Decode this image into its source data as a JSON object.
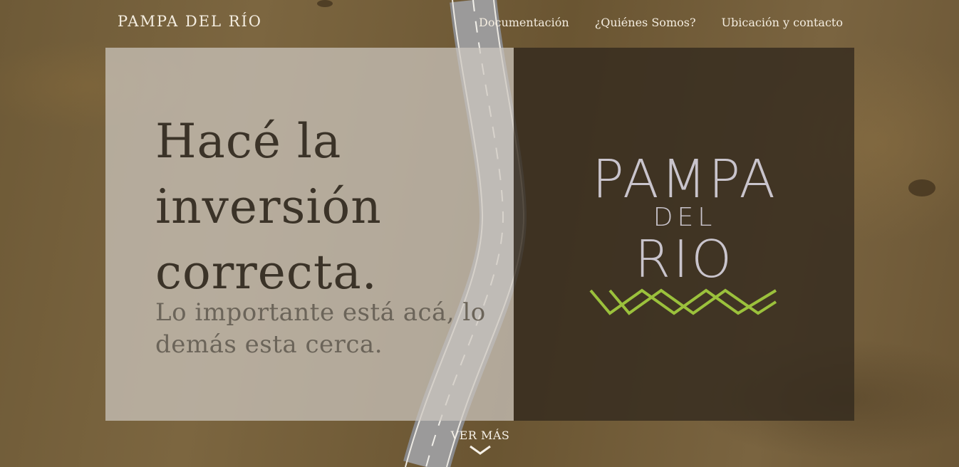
{
  "brand": "PAMPA DEL RÍO",
  "nav": {
    "items": [
      {
        "label": "Documentación"
      },
      {
        "label": "¿Quiénes Somos?"
      },
      {
        "label": "Ubicación y contacto"
      }
    ]
  },
  "hero": {
    "headline": "Hacé la inversión correcta.",
    "subline": "Lo importante está acá, lo demás esta cerca."
  },
  "logo": {
    "line1": "PAMPA",
    "line2": "DEL",
    "line3": "RIO",
    "accent_color": "#9bc13c"
  },
  "cta": {
    "label": "VER MÁS",
    "icon": "chevron-down-icon"
  }
}
